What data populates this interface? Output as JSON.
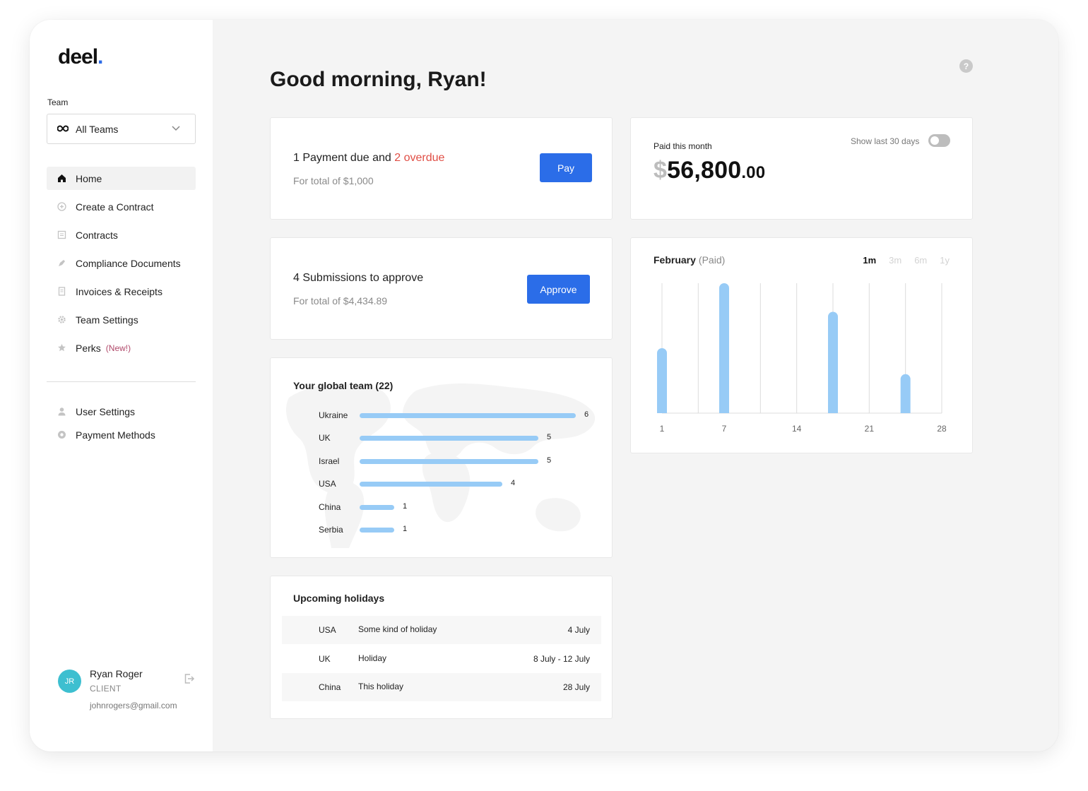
{
  "brand": {
    "name": "deel",
    "dot": "."
  },
  "sidebar": {
    "team_label": "Team",
    "team_select": {
      "icon": "infinity-icon",
      "value": "All Teams"
    },
    "nav": [
      {
        "label": "Home",
        "icon": "home-icon",
        "active": true
      },
      {
        "label": "Create a Contract",
        "icon": "plus-circle-icon"
      },
      {
        "label": "Contracts",
        "icon": "contract-icon"
      },
      {
        "label": "Compliance Documents",
        "icon": "pen-icon"
      },
      {
        "label": "Invoices & Receipts",
        "icon": "invoice-icon"
      },
      {
        "label": "Team Settings",
        "icon": "gear-icon"
      },
      {
        "label": "Perks",
        "icon": "star-icon",
        "badge": "(New!)"
      }
    ],
    "nav_secondary": [
      {
        "label": "User Settings",
        "icon": "user-icon"
      },
      {
        "label": "Payment Methods",
        "icon": "payment-icon"
      }
    ],
    "user": {
      "initials": "JR",
      "name": "Ryan Roger",
      "role": "CLIENT",
      "email": "johnrogers@gmail.com"
    }
  },
  "main": {
    "greeting": "Good morning, Ryan!",
    "payment_card": {
      "due_text": "1 Payment due and ",
      "overdue_text": "2 overdue",
      "total": "For total of $1,000",
      "button": "Pay"
    },
    "submissions_card": {
      "title": "4 Submissions to approve",
      "total": "For total of $4,434.89",
      "button": "Approve"
    },
    "paid_card": {
      "label": "Paid this month",
      "currency": "$",
      "amount": "56,800",
      "cents": ".00",
      "toggle_label": "Show last 30 days",
      "toggle_on": false
    },
    "chart_card": {
      "title": "February",
      "title_suffix": "(Paid)",
      "ranges": [
        "1m",
        "3m",
        "6m",
        "1y"
      ],
      "active_range": "1m"
    },
    "global_team": {
      "title": "Your global team (22)",
      "rows": [
        {
          "country": "Ukraine",
          "count": 6
        },
        {
          "country": "UK",
          "count": 5
        },
        {
          "country": "Israel",
          "count": 5
        },
        {
          "country": "USA",
          "count": 4
        },
        {
          "country": "China",
          "count": 1
        },
        {
          "country": "Serbia",
          "count": 1
        }
      ]
    },
    "holidays": {
      "title": "Upcoming holidays",
      "rows": [
        {
          "country": "USA",
          "name": "Some kind of holiday",
          "date": "4 July"
        },
        {
          "country": "UK",
          "name": "Holiday",
          "date": "8 July - 12 July"
        },
        {
          "country": "China",
          "name": "This holiday",
          "date": "28 July"
        }
      ]
    }
  },
  "chart_data": {
    "type": "bar",
    "title": "February (Paid)",
    "x_ticks": [
      1,
      7,
      14,
      21,
      28
    ],
    "x_range": [
      1,
      28
    ],
    "gridlines_x": [
      1,
      4.5,
      7,
      10.5,
      14,
      17.5,
      21,
      24.5,
      28
    ],
    "bars": [
      {
        "x": 1,
        "value": 0.5
      },
      {
        "x": 7,
        "value": 1.0
      },
      {
        "x": 17.5,
        "value": 0.78
      },
      {
        "x": 24.5,
        "value": 0.3
      }
    ],
    "ylim": [
      0,
      1
    ],
    "bar_color": "#97cbf6"
  },
  "colors": {
    "accent": "#2b6de8",
    "overdue": "#e04e45",
    "bar": "#97cbf6",
    "avatar": "#3dbfd0"
  }
}
